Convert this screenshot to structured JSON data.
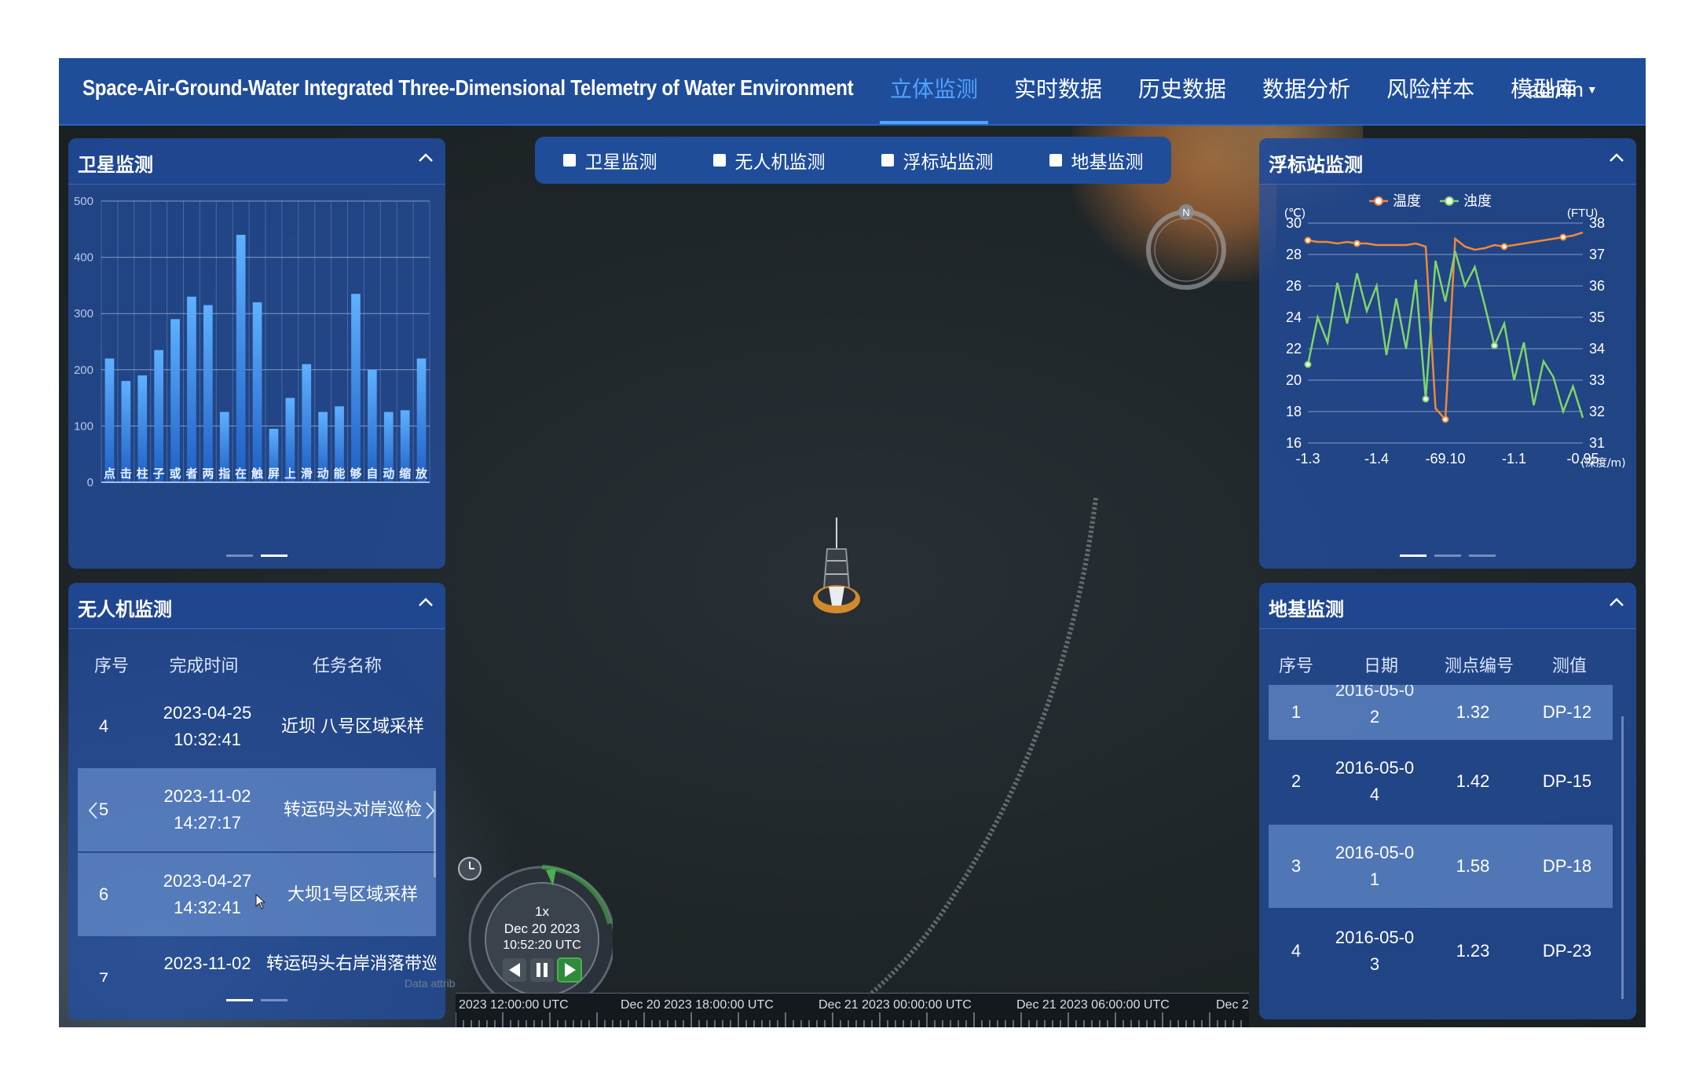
{
  "header": {
    "title": "Space-Air-Ground-Water Integrated Three-Dimensional Telemetry of Water Environment",
    "nav": [
      "立体监测",
      "实时数据",
      "历史数据",
      "数据分析",
      "风险样本",
      "模型库"
    ],
    "active_nav": "立体监测",
    "user": "admin"
  },
  "layers": [
    "卫星监测",
    "无人机监测",
    "浮标站监测",
    "地基监测"
  ],
  "satellite_panel": {
    "title": "卫星监测",
    "chart_data": {
      "type": "bar",
      "categories": [
        "点",
        "击",
        "柱",
        "子",
        "或",
        "者",
        "两",
        "指",
        "在",
        "触",
        "屏",
        "上",
        "滑",
        "动",
        "能",
        "够",
        "自",
        "动",
        "缩",
        "放"
      ],
      "values": [
        220,
        180,
        190,
        235,
        290,
        330,
        315,
        125,
        440,
        320,
        95,
        150,
        210,
        125,
        135,
        335,
        200,
        125,
        128,
        220
      ],
      "ylim": [
        0,
        500
      ],
      "yticks": [
        0,
        100,
        200,
        300,
        400,
        500
      ],
      "grid": true
    }
  },
  "uav_panel": {
    "title": "无人机监测",
    "columns": [
      "序号",
      "完成时间",
      "任务名称"
    ],
    "rows": [
      {
        "no": "4",
        "date": "2023-04-25",
        "time": "10:32:41",
        "task": "近坝 八号区域采样"
      },
      {
        "no": "5",
        "date": "2023-11-02",
        "time": "14:27:17",
        "task": "转运码头对岸巡检"
      },
      {
        "no": "6",
        "date": "2023-04-27",
        "time": "14:32:41",
        "task": "大坝1号区域采样"
      },
      {
        "no": "7",
        "date": "2023-11-02",
        "time": "",
        "task": "转运码头右岸消落带巡"
      }
    ]
  },
  "buoy_panel": {
    "title": "浮标站监测",
    "chart_data": {
      "type": "line",
      "series": [
        {
          "name": "温度",
          "axis": "left",
          "color": "#f0883a",
          "values": [
            28.9,
            28.8,
            28.8,
            28.7,
            28.8,
            28.7,
            28.7,
            28.6,
            28.6,
            28.6,
            28.6,
            28.7,
            28.5,
            18.2,
            17.5,
            29.0,
            28.5,
            28.3,
            28.4,
            28.6,
            28.5,
            28.6,
            28.7,
            28.8,
            28.9,
            29.0,
            29.1,
            29.2,
            29.4
          ]
        },
        {
          "name": "浊度",
          "axis": "right",
          "color": "#7fd46a",
          "values": [
            33.5,
            35.0,
            34.2,
            36.1,
            34.8,
            36.4,
            35.2,
            36.0,
            33.8,
            35.6,
            34.0,
            36.2,
            32.4,
            36.8,
            35.5,
            37.1,
            36.0,
            36.6,
            35.4,
            34.1,
            34.8,
            33.0,
            34.2,
            32.2,
            33.6,
            33.1,
            32.0,
            32.8,
            31.8
          ]
        }
      ],
      "x_ticks": [
        "-1.3",
        "-1.4",
        "-69.10",
        "-1.1",
        "-0.95"
      ],
      "x_unit": "(深度/m)",
      "y_left_unit": "(℃)",
      "y_left_ticks": [
        16,
        18,
        20,
        22,
        24,
        26,
        28,
        30
      ],
      "y_right_unit": "(FTU)",
      "y_right_ticks": [
        31,
        32,
        33,
        34,
        35,
        36,
        37,
        38
      ],
      "legend": "top"
    }
  },
  "ground_panel": {
    "title": "地基监测",
    "columns": [
      "序号",
      "日期",
      "测点编号",
      "测值"
    ],
    "rows": [
      {
        "no": "1",
        "date1": "2016-05-0",
        "date2": "2",
        "value": "1.32",
        "point": "DP-12"
      },
      {
        "no": "2",
        "date1": "2016-05-0",
        "date2": "4",
        "value": "1.42",
        "point": "DP-15"
      },
      {
        "no": "3",
        "date1": "2016-05-0",
        "date2": "1",
        "value": "1.58",
        "point": "DP-18"
      },
      {
        "no": "4",
        "date1": "2016-05-0",
        "date2": "3",
        "value": "1.23",
        "point": "DP-23"
      }
    ]
  },
  "clock": {
    "speed": "1x",
    "date": "Dec 20 2023",
    "time": "10:52:20 UTC"
  },
  "timeline": {
    "labels": [
      "2023 12:00:00 UTC",
      "Dec 20 2023 18:00:00 UTC",
      "Dec 21 2023 00:00:00 UTC",
      "Dec 21 2023 06:00:00 UTC",
      "Dec 2"
    ]
  },
  "map": {
    "compass": "N",
    "attribution": "Data attrib"
  }
}
